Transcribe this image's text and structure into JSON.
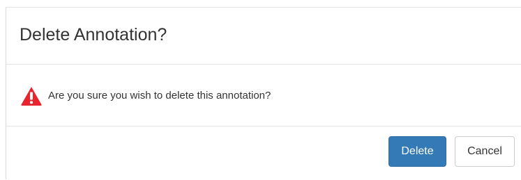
{
  "dialog": {
    "title": "Delete Annotation?",
    "message": "Are you sure you wish to delete this annotation?",
    "icon": "warning-triangle-icon",
    "delete_label": "Delete",
    "cancel_label": "Cancel"
  },
  "colors": {
    "primary": "#337ab7",
    "warning": "#e8252f"
  }
}
